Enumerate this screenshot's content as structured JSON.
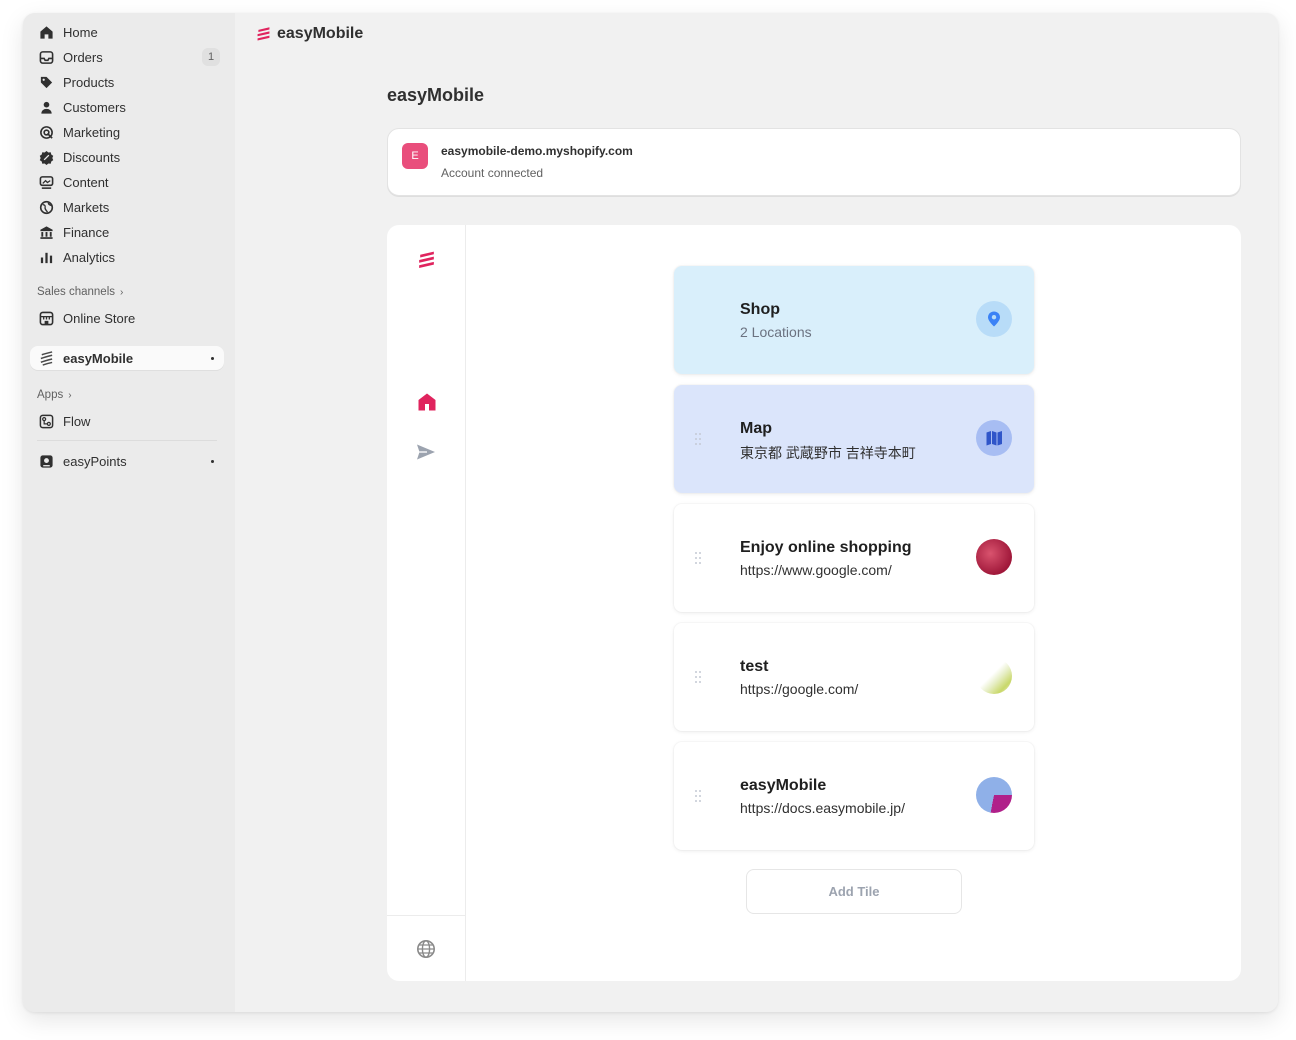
{
  "sidebar": {
    "items": [
      {
        "label": "Home",
        "icon": "home-icon"
      },
      {
        "label": "Orders",
        "icon": "inbox-icon",
        "badge": "1"
      },
      {
        "label": "Products",
        "icon": "tag-icon"
      },
      {
        "label": "Customers",
        "icon": "person-icon"
      },
      {
        "label": "Marketing",
        "icon": "target-icon"
      },
      {
        "label": "Discounts",
        "icon": "discount-icon"
      },
      {
        "label": "Content",
        "icon": "content-icon"
      },
      {
        "label": "Markets",
        "icon": "globe-icon"
      },
      {
        "label": "Finance",
        "icon": "bank-icon"
      },
      {
        "label": "Analytics",
        "icon": "bar-chart-icon"
      }
    ],
    "sales_channels_label": "Sales channels",
    "online_store": "Online Store",
    "easymobile": "easyMobile",
    "apps_label": "Apps",
    "flow": "Flow",
    "easypoints": "easyPoints"
  },
  "header": {
    "app_name": "easyMobile"
  },
  "page": {
    "title": "easyMobile"
  },
  "account": {
    "avatar_letter": "E",
    "domain": "easymobile-demo.myshopify.com",
    "status": "Account connected"
  },
  "tiles": [
    {
      "title": "Shop",
      "subtitle": "2 Locations",
      "icon": "location-pin-icon"
    },
    {
      "title": "Map",
      "subtitle": "東京都 武蔵野市 吉祥寺本町",
      "icon": "map-icon"
    },
    {
      "title": "Enjoy online shopping",
      "subtitle": "https://www.google.com/",
      "icon": "thumbnail-image"
    },
    {
      "title": "test",
      "subtitle": "https://google.com/",
      "icon": "thumbnail-image"
    },
    {
      "title": "easyMobile",
      "subtitle": "https://docs.easymobile.jp/",
      "icon": "thumbnail-image"
    }
  ],
  "add_tile_label": "Add Tile",
  "colors": {
    "brand": "#e0245e",
    "shop_tile": "#d9effb",
    "map_tile": "#dbe5fb"
  }
}
